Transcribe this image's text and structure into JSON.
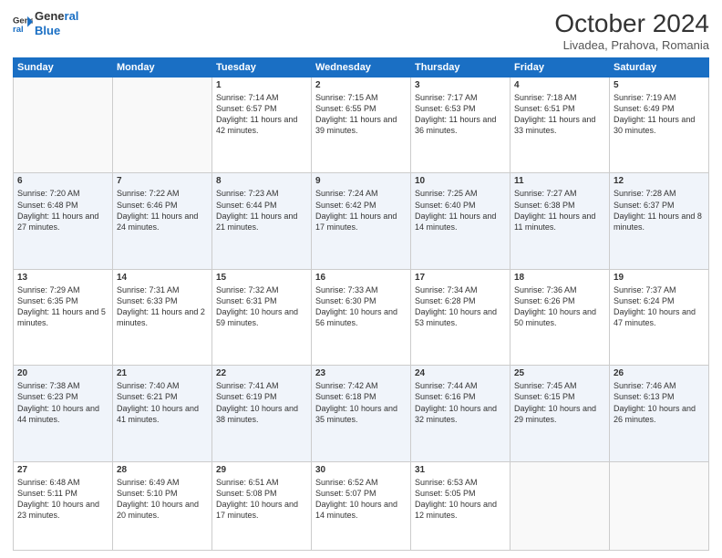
{
  "header": {
    "logo_line1": "General",
    "logo_line2": "Blue",
    "month": "October 2024",
    "location": "Livadea, Prahova, Romania"
  },
  "days_of_week": [
    "Sunday",
    "Monday",
    "Tuesday",
    "Wednesday",
    "Thursday",
    "Friday",
    "Saturday"
  ],
  "weeks": [
    [
      {
        "day": "",
        "sunrise": "",
        "sunset": "",
        "daylight": ""
      },
      {
        "day": "",
        "sunrise": "",
        "sunset": "",
        "daylight": ""
      },
      {
        "day": "1",
        "sunrise": "Sunrise: 7:14 AM",
        "sunset": "Sunset: 6:57 PM",
        "daylight": "Daylight: 11 hours and 42 minutes."
      },
      {
        "day": "2",
        "sunrise": "Sunrise: 7:15 AM",
        "sunset": "Sunset: 6:55 PM",
        "daylight": "Daylight: 11 hours and 39 minutes."
      },
      {
        "day": "3",
        "sunrise": "Sunrise: 7:17 AM",
        "sunset": "Sunset: 6:53 PM",
        "daylight": "Daylight: 11 hours and 36 minutes."
      },
      {
        "day": "4",
        "sunrise": "Sunrise: 7:18 AM",
        "sunset": "Sunset: 6:51 PM",
        "daylight": "Daylight: 11 hours and 33 minutes."
      },
      {
        "day": "5",
        "sunrise": "Sunrise: 7:19 AM",
        "sunset": "Sunset: 6:49 PM",
        "daylight": "Daylight: 11 hours and 30 minutes."
      }
    ],
    [
      {
        "day": "6",
        "sunrise": "Sunrise: 7:20 AM",
        "sunset": "Sunset: 6:48 PM",
        "daylight": "Daylight: 11 hours and 27 minutes."
      },
      {
        "day": "7",
        "sunrise": "Sunrise: 7:22 AM",
        "sunset": "Sunset: 6:46 PM",
        "daylight": "Daylight: 11 hours and 24 minutes."
      },
      {
        "day": "8",
        "sunrise": "Sunrise: 7:23 AM",
        "sunset": "Sunset: 6:44 PM",
        "daylight": "Daylight: 11 hours and 21 minutes."
      },
      {
        "day": "9",
        "sunrise": "Sunrise: 7:24 AM",
        "sunset": "Sunset: 6:42 PM",
        "daylight": "Daylight: 11 hours and 17 minutes."
      },
      {
        "day": "10",
        "sunrise": "Sunrise: 7:25 AM",
        "sunset": "Sunset: 6:40 PM",
        "daylight": "Daylight: 11 hours and 14 minutes."
      },
      {
        "day": "11",
        "sunrise": "Sunrise: 7:27 AM",
        "sunset": "Sunset: 6:38 PM",
        "daylight": "Daylight: 11 hours and 11 minutes."
      },
      {
        "day": "12",
        "sunrise": "Sunrise: 7:28 AM",
        "sunset": "Sunset: 6:37 PM",
        "daylight": "Daylight: 11 hours and 8 minutes."
      }
    ],
    [
      {
        "day": "13",
        "sunrise": "Sunrise: 7:29 AM",
        "sunset": "Sunset: 6:35 PM",
        "daylight": "Daylight: 11 hours and 5 minutes."
      },
      {
        "day": "14",
        "sunrise": "Sunrise: 7:31 AM",
        "sunset": "Sunset: 6:33 PM",
        "daylight": "Daylight: 11 hours and 2 minutes."
      },
      {
        "day": "15",
        "sunrise": "Sunrise: 7:32 AM",
        "sunset": "Sunset: 6:31 PM",
        "daylight": "Daylight: 10 hours and 59 minutes."
      },
      {
        "day": "16",
        "sunrise": "Sunrise: 7:33 AM",
        "sunset": "Sunset: 6:30 PM",
        "daylight": "Daylight: 10 hours and 56 minutes."
      },
      {
        "day": "17",
        "sunrise": "Sunrise: 7:34 AM",
        "sunset": "Sunset: 6:28 PM",
        "daylight": "Daylight: 10 hours and 53 minutes."
      },
      {
        "day": "18",
        "sunrise": "Sunrise: 7:36 AM",
        "sunset": "Sunset: 6:26 PM",
        "daylight": "Daylight: 10 hours and 50 minutes."
      },
      {
        "day": "19",
        "sunrise": "Sunrise: 7:37 AM",
        "sunset": "Sunset: 6:24 PM",
        "daylight": "Daylight: 10 hours and 47 minutes."
      }
    ],
    [
      {
        "day": "20",
        "sunrise": "Sunrise: 7:38 AM",
        "sunset": "Sunset: 6:23 PM",
        "daylight": "Daylight: 10 hours and 44 minutes."
      },
      {
        "day": "21",
        "sunrise": "Sunrise: 7:40 AM",
        "sunset": "Sunset: 6:21 PM",
        "daylight": "Daylight: 10 hours and 41 minutes."
      },
      {
        "day": "22",
        "sunrise": "Sunrise: 7:41 AM",
        "sunset": "Sunset: 6:19 PM",
        "daylight": "Daylight: 10 hours and 38 minutes."
      },
      {
        "day": "23",
        "sunrise": "Sunrise: 7:42 AM",
        "sunset": "Sunset: 6:18 PM",
        "daylight": "Daylight: 10 hours and 35 minutes."
      },
      {
        "day": "24",
        "sunrise": "Sunrise: 7:44 AM",
        "sunset": "Sunset: 6:16 PM",
        "daylight": "Daylight: 10 hours and 32 minutes."
      },
      {
        "day": "25",
        "sunrise": "Sunrise: 7:45 AM",
        "sunset": "Sunset: 6:15 PM",
        "daylight": "Daylight: 10 hours and 29 minutes."
      },
      {
        "day": "26",
        "sunrise": "Sunrise: 7:46 AM",
        "sunset": "Sunset: 6:13 PM",
        "daylight": "Daylight: 10 hours and 26 minutes."
      }
    ],
    [
      {
        "day": "27",
        "sunrise": "Sunrise: 6:48 AM",
        "sunset": "Sunset: 5:11 PM",
        "daylight": "Daylight: 10 hours and 23 minutes."
      },
      {
        "day": "28",
        "sunrise": "Sunrise: 6:49 AM",
        "sunset": "Sunset: 5:10 PM",
        "daylight": "Daylight: 10 hours and 20 minutes."
      },
      {
        "day": "29",
        "sunrise": "Sunrise: 6:51 AM",
        "sunset": "Sunset: 5:08 PM",
        "daylight": "Daylight: 10 hours and 17 minutes."
      },
      {
        "day": "30",
        "sunrise": "Sunrise: 6:52 AM",
        "sunset": "Sunset: 5:07 PM",
        "daylight": "Daylight: 10 hours and 14 minutes."
      },
      {
        "day": "31",
        "sunrise": "Sunrise: 6:53 AM",
        "sunset": "Sunset: 5:05 PM",
        "daylight": "Daylight: 10 hours and 12 minutes."
      },
      {
        "day": "",
        "sunrise": "",
        "sunset": "",
        "daylight": ""
      },
      {
        "day": "",
        "sunrise": "",
        "sunset": "",
        "daylight": ""
      }
    ]
  ]
}
